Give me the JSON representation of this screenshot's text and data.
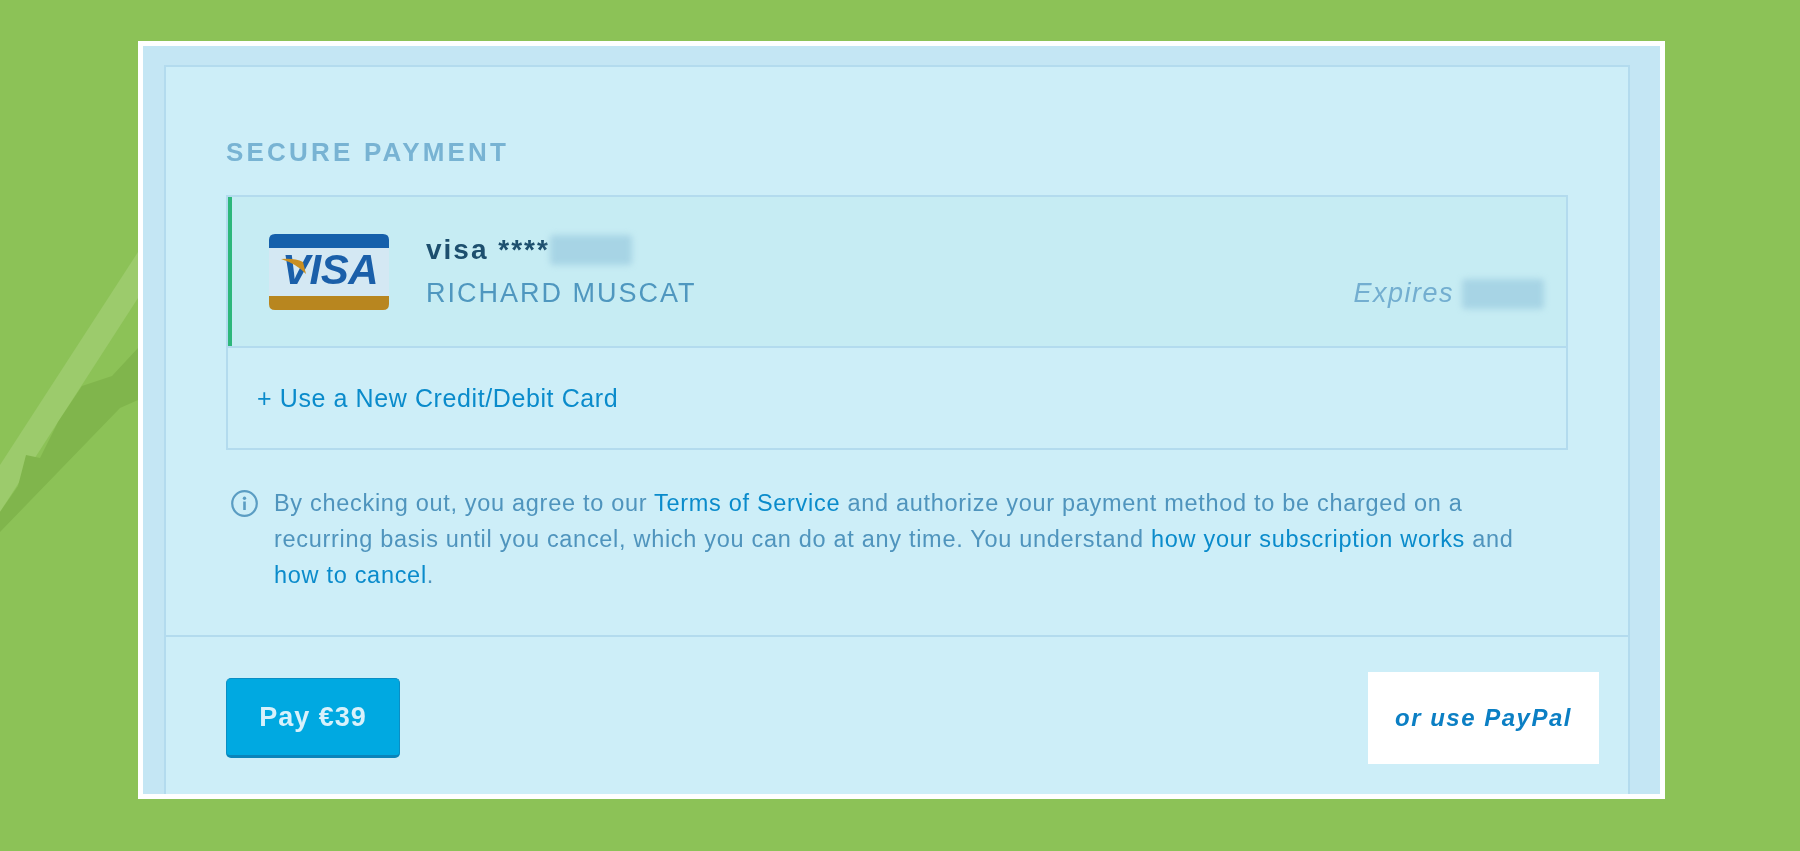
{
  "heading": "SECURE PAYMENT",
  "saved_cards": [
    {
      "brand": "VISA",
      "label": "visa ****",
      "holder": "RICHARD MUSCAT",
      "expires_label": "Expires",
      "selected": true
    }
  ],
  "new_card_link": "+ Use a New Credit/Debit Card",
  "notice": {
    "segments": [
      {
        "kind": "text",
        "text": "By checking out, you agree to our "
      },
      {
        "kind": "link",
        "text": "Terms of Service"
      },
      {
        "kind": "text",
        "text": " and authorize your payment method to be charged on a recurring basis until you cancel, which you can do at any time. You understand "
      },
      {
        "kind": "link",
        "text": "how your subscription works"
      },
      {
        "kind": "text",
        "text": " and "
      },
      {
        "kind": "link",
        "text": "how to cancel"
      },
      {
        "kind": "text",
        "text": "."
      }
    ]
  },
  "footer": {
    "pay_button": "Pay €39",
    "paypal_button": "or use PayPal"
  }
}
